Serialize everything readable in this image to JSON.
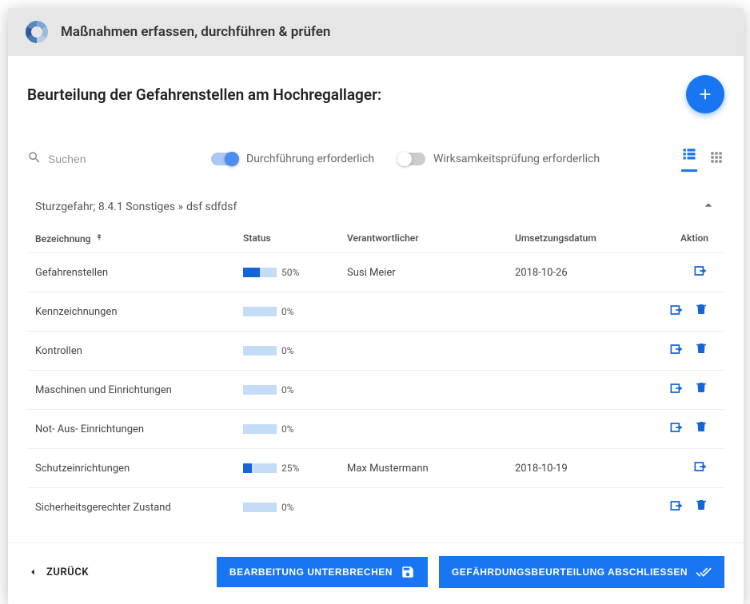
{
  "header": {
    "title": "Maßnahmen erfassen, durchführen & prüfen"
  },
  "page": {
    "title": "Beurteilung der Gefahrenstellen am Hochregallager:"
  },
  "search": {
    "placeholder": "Suchen"
  },
  "toggles": {
    "execution": {
      "label": "Durchführung erforderlich",
      "on": true
    },
    "effectiveness": {
      "label": "Wirksamkeitsprüfung erforderlich",
      "on": false
    }
  },
  "group": {
    "prefix": "Sturzgefahr; 8.4.1 Sonstiges » ",
    "suffix": "dsf sdfdsf"
  },
  "columns": {
    "name": "Bezeichnung",
    "status": "Status",
    "responsible": "Verantwortlicher",
    "date": "Umsetzungsdatum",
    "action": "Aktion"
  },
  "rows": [
    {
      "name": "Gefahrenstellen",
      "percent": 50,
      "responsible": "Susi Meier",
      "date": "2018-10-26",
      "deletable": false
    },
    {
      "name": "Kennzeichnungen",
      "percent": 0,
      "responsible": "",
      "date": "",
      "deletable": true
    },
    {
      "name": "Kontrollen",
      "percent": 0,
      "responsible": "",
      "date": "",
      "deletable": true
    },
    {
      "name": "Maschinen und Einrichtungen",
      "percent": 0,
      "responsible": "",
      "date": "",
      "deletable": true
    },
    {
      "name": "Not- Aus- Einrichtungen",
      "percent": 0,
      "responsible": "",
      "date": "",
      "deletable": true
    },
    {
      "name": "Schutzeinrichtungen",
      "percent": 25,
      "responsible": "Max Mustermann",
      "date": "2018-10-19",
      "deletable": false
    },
    {
      "name": "Sicherheitsgerechter Zustand",
      "percent": 0,
      "responsible": "",
      "date": "",
      "deletable": true
    }
  ],
  "footer": {
    "back": "ZURÜCK",
    "pause": "BEARBEITUNG UNTERBRECHEN",
    "finish": "GEFÄHRDUNGSBEURTEILUNG ABSCHLIESSEN"
  }
}
